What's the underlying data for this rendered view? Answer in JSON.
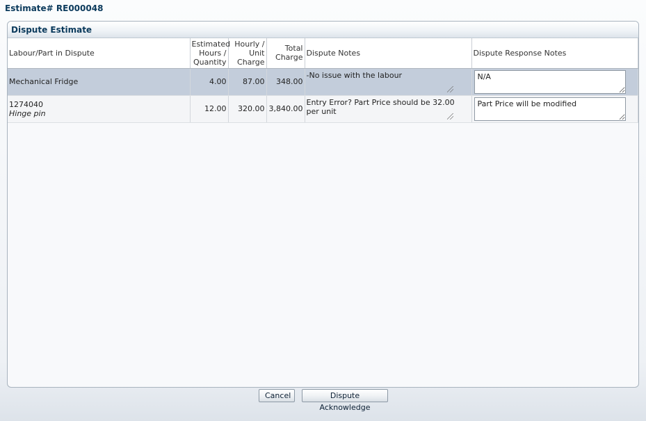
{
  "page": {
    "title": "Estimate# RE000048"
  },
  "panel": {
    "title": "Dispute Estimate"
  },
  "table": {
    "columns": [
      {
        "label_lines": [
          "Labour/Part in Dispute"
        ]
      },
      {
        "label_lines": [
          "Estimated",
          "Hours /",
          "Quantity"
        ]
      },
      {
        "label_lines": [
          "Hourly /",
          "Unit",
          "Charge"
        ]
      },
      {
        "label_lines": [
          "Total",
          "Charge"
        ]
      },
      {
        "label_lines": [
          "Dispute Notes"
        ]
      },
      {
        "label_lines": [
          "Dispute Response Notes"
        ]
      }
    ],
    "rows": [
      {
        "item": "Mechanical Fridge",
        "description": "",
        "hours_qty": "4.00",
        "unit_charge": "87.00",
        "total_charge": "348.00",
        "dispute_notes": "-No issue with the labour",
        "response_notes": "N/A",
        "selected": true
      },
      {
        "item": "1274040",
        "description": "Hinge pin",
        "hours_qty": "12.00",
        "unit_charge": "320.00",
        "total_charge": "3,840.00",
        "dispute_notes": "Entry Error? Part Price should be 32.00 per unit",
        "response_notes": "Part Price will be modified",
        "selected": false
      }
    ]
  },
  "buttons": {
    "cancel": "Cancel",
    "acknowledge": "Dispute Acknowledge"
  },
  "colors": {
    "title": "#0b3a5c",
    "selected_row": "#c3cddb",
    "normal_row": "#f4f5f7"
  }
}
